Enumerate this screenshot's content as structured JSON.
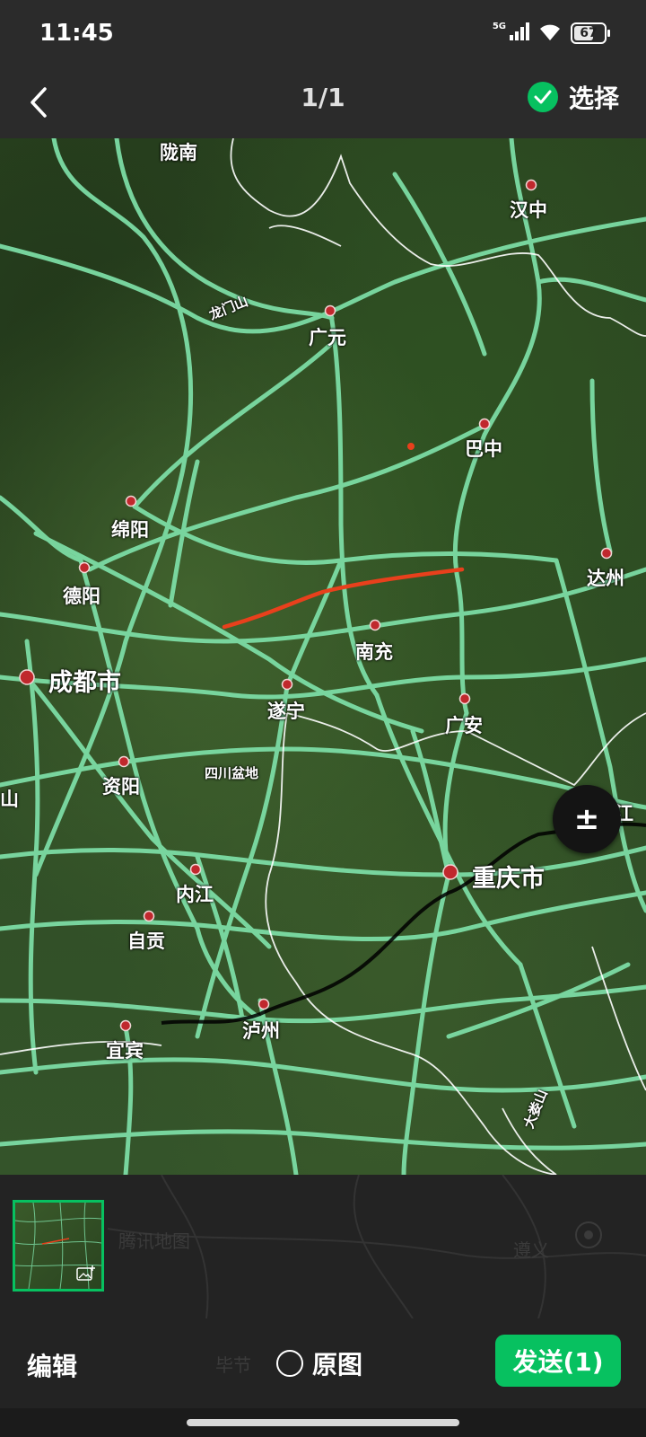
{
  "status_bar": {
    "time": "11:45",
    "network": "5G",
    "battery": "67",
    "battery_level": 0.67
  },
  "header": {
    "back_icon": "chevron-left-icon",
    "counter": "1/1",
    "select_label": "选择",
    "select_icon": "check-circle-icon"
  },
  "map": {
    "cities": {
      "longnan": "陇南",
      "hanzhong": "汉中",
      "longmenshan": "龙门山",
      "guangyuan": "广元",
      "bazhong": "巴中",
      "mianyang": "绵阳",
      "dazhou": "达州",
      "deyang": "德阳",
      "nanchong": "南充",
      "chengdu": "成都市",
      "suining": "遂宁",
      "guangan": "广安",
      "ziyang": "资阳",
      "sichuan_basin": "四川盆地",
      "shan": "山",
      "changjiang": "长江",
      "neijiang": "内江",
      "chongqing": "重庆市",
      "zigong": "自贡",
      "luzhou": "泸州",
      "yibin": "宜宾",
      "dalou": "大娄山"
    },
    "zoom_label": "±",
    "route_color": "#e8401c",
    "road_color": "#7ee0a8"
  },
  "thumbnail_strip": {
    "watermark": "腾讯地图",
    "ghost_city_1": "遵义",
    "ghost_city_2": "毕节"
  },
  "bottom_bar": {
    "edit_label": "编辑",
    "original_label": "原图",
    "send_label": "发送(1)"
  },
  "colors": {
    "accent": "#07c160",
    "bar_bg": "#2b2b2b"
  }
}
